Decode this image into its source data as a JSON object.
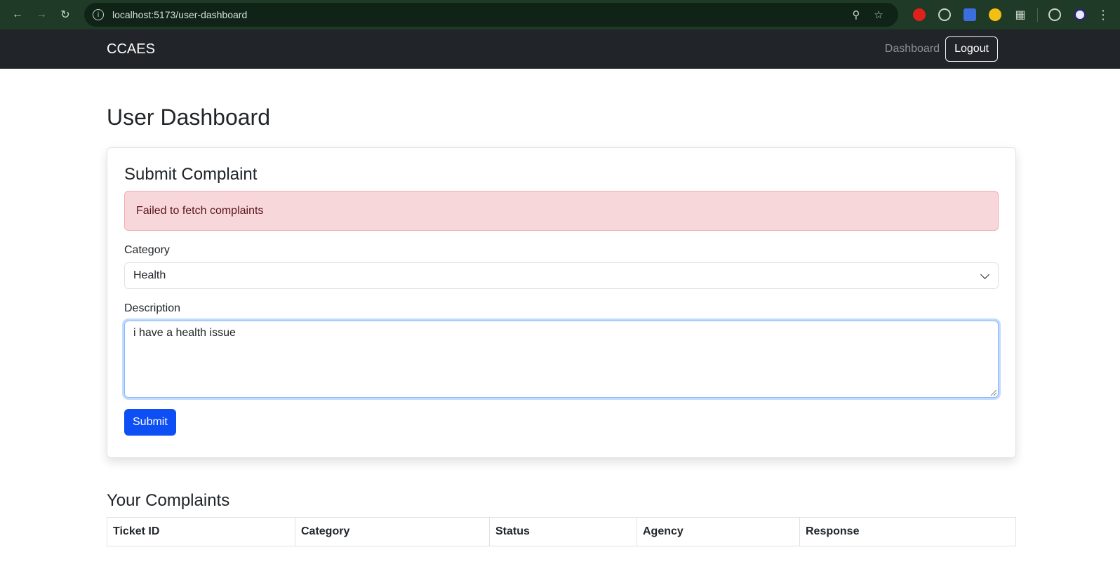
{
  "browser": {
    "url": "localhost:5173/user-dashboard"
  },
  "navbar": {
    "brand": "CCAES",
    "dashboard_link": "Dashboard",
    "logout_label": "Logout"
  },
  "page": {
    "title": "User Dashboard"
  },
  "complaint_form": {
    "title": "Submit Complaint",
    "error_message": "Failed to fetch complaints",
    "category_label": "Category",
    "category_value": "Health",
    "description_label": "Description",
    "description_value": "i have a health issue",
    "submit_label": "Submit"
  },
  "complaints": {
    "title": "Your Complaints",
    "columns": [
      "Ticket ID",
      "Category",
      "Status",
      "Agency",
      "Response"
    ]
  },
  "colors": {
    "navbar_bg": "#212529",
    "primary": "#0d4ff5",
    "alert_bg": "#f8d7da"
  }
}
